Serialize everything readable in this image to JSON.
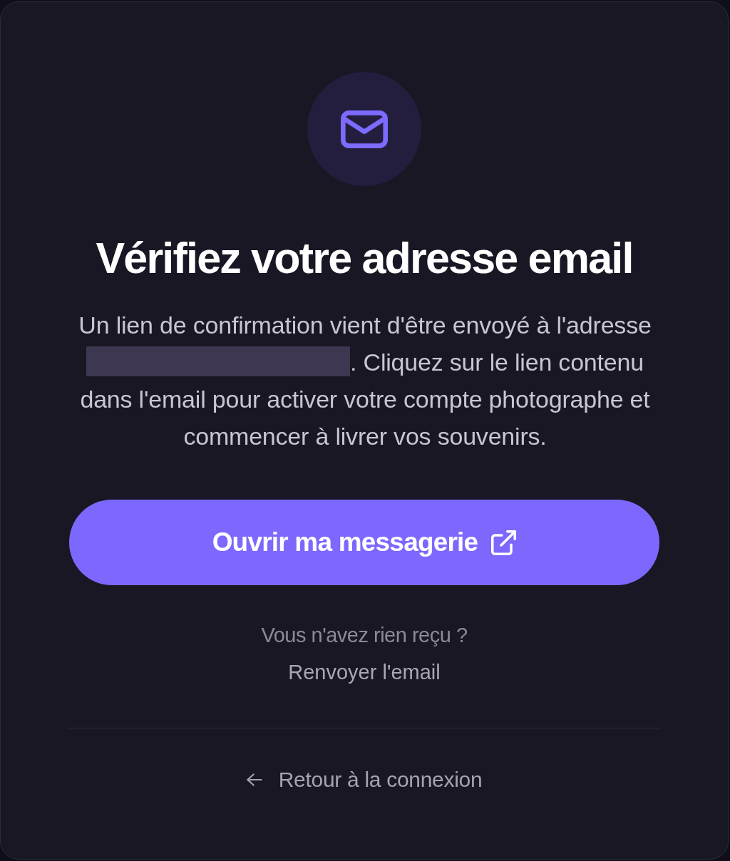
{
  "title": "Vérifiez votre adresse email",
  "message": {
    "before": "Un lien de confirmation vient d'être envoyé à l'adresse",
    "redacted": true,
    "after": ". Cliquez sur le lien contenu dans l'email pour activer votre compte photographe et commencer à livrer vos souvenirs."
  },
  "primary_button": {
    "label": "Ouvrir ma messagerie"
  },
  "resend": {
    "prompt": "Vous n'avez rien reçu ?",
    "link": "Renvoyer l'email"
  },
  "back_link": {
    "label": "Retour à la connexion"
  }
}
